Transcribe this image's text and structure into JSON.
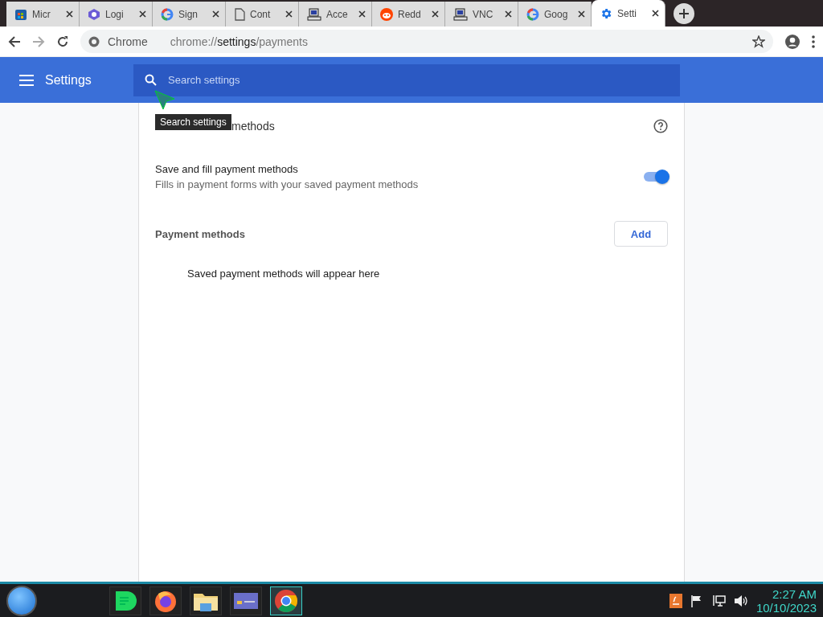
{
  "tabs": [
    {
      "title": "Micr",
      "kind": "store",
      "selected": false
    },
    {
      "title": "Logi",
      "kind": "puzzle",
      "selected": false
    },
    {
      "title": "Sign",
      "kind": "google",
      "selected": false
    },
    {
      "title": "Cont",
      "kind": "page",
      "selected": false
    },
    {
      "title": "Acce",
      "kind": "computer",
      "selected": false
    },
    {
      "title": "Redd",
      "kind": "reddit",
      "selected": false
    },
    {
      "title": "VNC",
      "kind": "computer",
      "selected": false
    },
    {
      "title": "Goog",
      "kind": "google",
      "selected": false
    },
    {
      "title": "Setti",
      "kind": "gear",
      "selected": true
    }
  ],
  "address": {
    "site": "Chrome",
    "url_prefix": "chrome://",
    "url_host": "settings",
    "url_path": "/payments"
  },
  "header": {
    "title": "Settings",
    "search_placeholder": "Search settings"
  },
  "tooltip": "Search settings",
  "section": {
    "heading": "methods",
    "toggle_row": {
      "label": "Save and fill payment methods",
      "description": "Fills in payment forms with your saved payment methods",
      "on": true
    },
    "list_label": "Payment methods",
    "add_button": "Add",
    "empty_text": "Saved payment methods will appear here"
  },
  "taskbar": {
    "apps": [
      {
        "kind": "notes",
        "selected": false
      },
      {
        "kind": "firefox",
        "selected": false
      },
      {
        "kind": "folder",
        "selected": false
      },
      {
        "kind": "card",
        "selected": false
      },
      {
        "kind": "chrome",
        "selected": true
      }
    ],
    "time": "2:27 AM",
    "date": "10/10/2023"
  }
}
